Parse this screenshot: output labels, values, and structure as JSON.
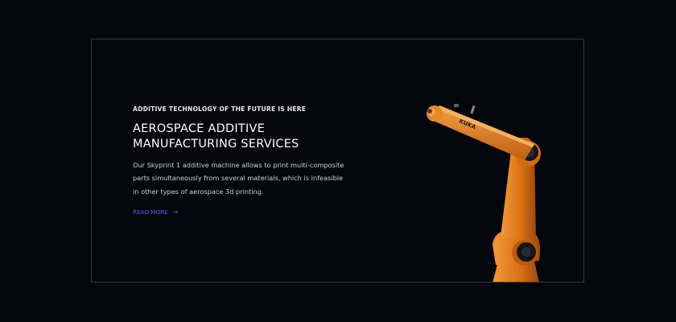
{
  "hero": {
    "eyebrow": "ADDITIVE TECHNOLOGY OF THE FUTURE IS HERE",
    "title_lines": [
      "AEROSPACE ADDITIVE",
      "MANUFACTURING SERVICES"
    ],
    "description_lines": [
      "Our Skyprint 1 additive machine allows to print multi-composite",
      "parts simultaneously from several materials, which is infeasible",
      "in other types of aerospace 3d printing."
    ],
    "cta_label": "READ MORE",
    "cta_arrow": "→",
    "robot_brand": "KUKA"
  },
  "colors": {
    "background": "#06060f",
    "accent": "#3b6cf0",
    "robot_orange": "#e07a1f"
  },
  "icons": {
    "cta_arrow": "arrow-right-icon",
    "robot": "industrial-robot-arm-icon"
  }
}
